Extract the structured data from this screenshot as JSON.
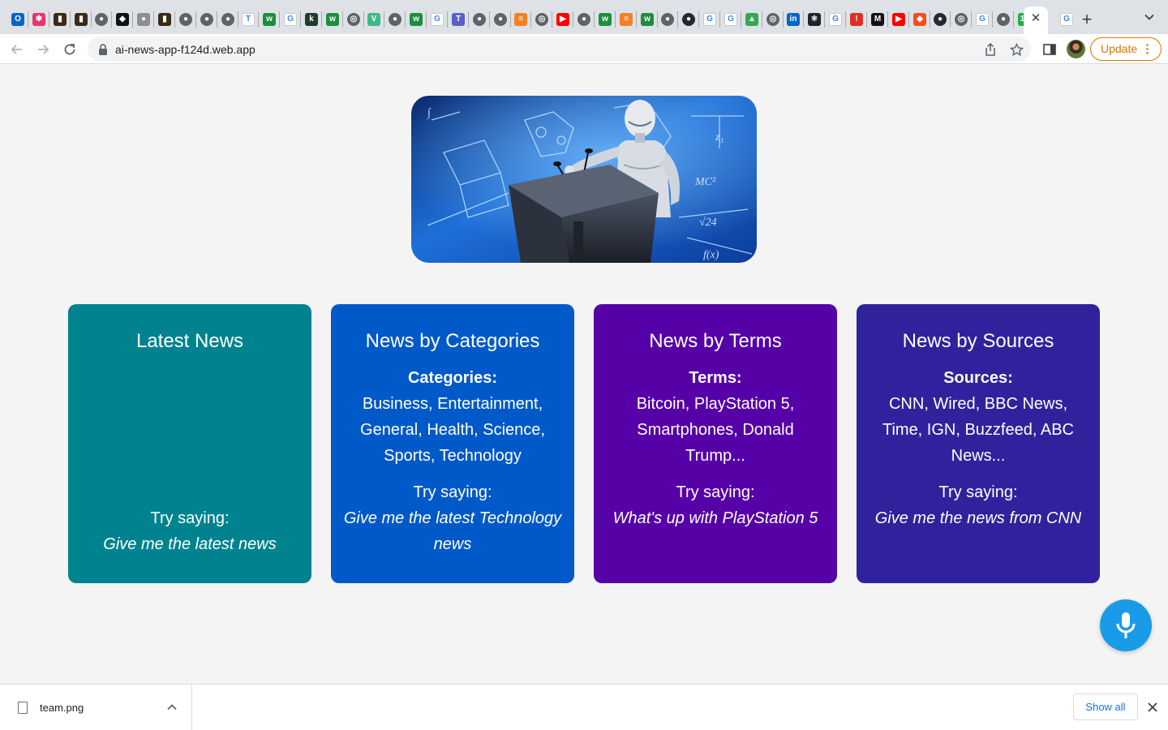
{
  "browser": {
    "address": "ai-news-app-f124d.web.app",
    "update_label": "Update",
    "tabs": [
      {
        "icon": "outlook-icon",
        "color": "#0a64c8",
        "glyph": "O"
      },
      {
        "icon": "asterisk-icon",
        "color": "#e8336d",
        "glyph": "✱"
      },
      {
        "icon": "book-icon",
        "color": "#3b2a16",
        "glyph": "▮"
      },
      {
        "icon": "book-icon",
        "color": "#3b2a16",
        "glyph": "▮"
      },
      {
        "icon": "globe-icon",
        "color": "#5f6368",
        "glyph": "●"
      },
      {
        "icon": "diamond-icon",
        "color": "#111111",
        "glyph": "◆"
      },
      {
        "icon": "apple-icon",
        "color": "#8e8e93",
        "glyph": "●"
      },
      {
        "icon": "book-icon",
        "color": "#3b2a16",
        "glyph": "▮"
      },
      {
        "icon": "globe-icon",
        "color": "#5f6368",
        "glyph": "●"
      },
      {
        "icon": "globe-icon",
        "color": "#5f6368",
        "glyph": "●"
      },
      {
        "icon": "globe-icon",
        "color": "#5f6368",
        "glyph": "●"
      },
      {
        "icon": "text-icon",
        "color": "#ffffff",
        "glyph": "T"
      },
      {
        "icon": "wix-icon",
        "color": "#1e8e3e",
        "glyph": "w"
      },
      {
        "icon": "google-icon",
        "color": "#ffffff",
        "glyph": "G"
      },
      {
        "icon": "cursor-icon",
        "color": "#1f3b2c",
        "glyph": "k"
      },
      {
        "icon": "wix-icon",
        "color": "#1e8e3e",
        "glyph": "w"
      },
      {
        "icon": "chrome-icon",
        "color": "#5f6368",
        "glyph": "◎"
      },
      {
        "icon": "vue-icon",
        "color": "#41b883",
        "glyph": "V"
      },
      {
        "icon": "globe-icon",
        "color": "#5f6368",
        "glyph": "●"
      },
      {
        "icon": "wix-icon",
        "color": "#1e8e3e",
        "glyph": "w"
      },
      {
        "icon": "google-icon",
        "color": "#ffffff",
        "glyph": "G"
      },
      {
        "icon": "teams-icon",
        "color": "#5b5fc7",
        "glyph": "T"
      },
      {
        "icon": "globe-icon",
        "color": "#5f6368",
        "glyph": "●"
      },
      {
        "icon": "globe-icon",
        "color": "#5f6368",
        "glyph": "●"
      },
      {
        "icon": "stackoverflow-icon",
        "color": "#f48024",
        "glyph": "≡"
      },
      {
        "icon": "chrome-icon",
        "color": "#5f6368",
        "glyph": "◎"
      },
      {
        "icon": "youtube-icon",
        "color": "#ff0000",
        "glyph": "▶"
      },
      {
        "icon": "globe-icon",
        "color": "#5f6368",
        "glyph": "●"
      },
      {
        "icon": "wix-icon",
        "color": "#1e8e3e",
        "glyph": "w"
      },
      {
        "icon": "stackoverflow-icon",
        "color": "#f48024",
        "glyph": "≡"
      },
      {
        "icon": "wix-icon",
        "color": "#1e8e3e",
        "glyph": "w"
      },
      {
        "icon": "globe-icon",
        "color": "#5f6368",
        "glyph": "●"
      },
      {
        "icon": "github-icon",
        "color": "#24292f",
        "glyph": "●"
      },
      {
        "icon": "google-icon",
        "color": "#ffffff",
        "glyph": "G"
      },
      {
        "icon": "google-icon",
        "color": "#ffffff",
        "glyph": "G"
      },
      {
        "icon": "drive-icon",
        "color": "#34a853",
        "glyph": "▲"
      },
      {
        "icon": "chrome-icon",
        "color": "#5f6368",
        "glyph": "◎"
      },
      {
        "icon": "linkedin-icon",
        "color": "#0a66c2",
        "glyph": "in"
      },
      {
        "icon": "react-icon",
        "color": "#20232a",
        "glyph": "⚛"
      },
      {
        "icon": "google-icon",
        "color": "#ffffff",
        "glyph": "G"
      },
      {
        "icon": "alert-icon",
        "color": "#d93025",
        "glyph": "!"
      },
      {
        "icon": "medium-icon",
        "color": "#111111",
        "glyph": "M"
      },
      {
        "icon": "youtube-icon",
        "color": "#ff0000",
        "glyph": "▶"
      },
      {
        "icon": "figma-icon",
        "color": "#f24e1e",
        "glyph": "◆"
      },
      {
        "icon": "github-icon",
        "color": "#24292f",
        "glyph": "●"
      },
      {
        "icon": "chrome-icon",
        "color": "#5f6368",
        "glyph": "◎"
      },
      {
        "icon": "google-icon",
        "color": "#ffffff",
        "glyph": "G"
      },
      {
        "icon": "globe-icon",
        "color": "#5f6368",
        "glyph": "●"
      },
      {
        "icon": "badge-icon",
        "color": "#1fb141",
        "glyph": "19"
      },
      {
        "icon": "close-icon",
        "color": "#ffffff",
        "glyph": "×",
        "active": true
      },
      {
        "icon": "google-icon",
        "color": "#ffffff",
        "glyph": "G"
      }
    ]
  },
  "hero": {
    "alt": "robot at podium"
  },
  "cards": [
    {
      "title": "Latest News",
      "label": "",
      "body": "",
      "try_label": "Try saying:",
      "try_text": "Give me the latest news",
      "color": "#00838f"
    },
    {
      "title": "News by Categories",
      "label": "Categories:",
      "body": "Business, Entertainment, General, Health, Science, Sports, Technology",
      "try_label": "Try saying:",
      "try_text": "Give me the latest Technology news",
      "color": "#0059c9"
    },
    {
      "title": "News by Terms",
      "label": "Terms:",
      "body": "Bitcoin, PlayStation 5, Smartphones, Donald Trump...",
      "try_label": "Try saying:",
      "try_text": "What's up with PlayStation 5",
      "color": "#5600a8"
    },
    {
      "title": "News by Sources",
      "label": "Sources:",
      "body": "CNN, Wired, BBC News, Time, IGN, Buzzfeed, ABC News...",
      "try_label": "Try saying:",
      "try_text": "Give me the news from CNN",
      "color": "#30229c"
    }
  ],
  "download_bar": {
    "file_name": "team.png",
    "show_all_label": "Show all"
  }
}
